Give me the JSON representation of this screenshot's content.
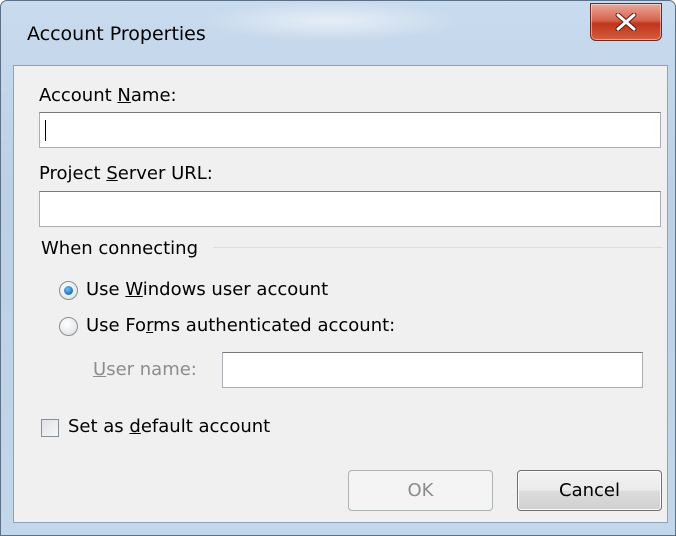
{
  "window": {
    "title": "Account Properties",
    "close_icon": "close-x-icon"
  },
  "fields": {
    "account_name": {
      "label_pre": "Account ",
      "label_key": "N",
      "label_post": "ame:",
      "value": ""
    },
    "project_server_url": {
      "label_pre": "Project ",
      "label_key": "S",
      "label_post": "erver URL:",
      "value": ""
    }
  },
  "connecting": {
    "group_label": "When connecting",
    "windows_option": {
      "label_pre": "Use ",
      "label_key": "W",
      "label_post": "indows user account",
      "checked": true
    },
    "forms_option": {
      "label_pre": "Use Fo",
      "label_key": "r",
      "label_post": "ms authenticated account:",
      "checked": false
    },
    "username": {
      "label_key": "U",
      "label_post": "ser name:",
      "value": ""
    }
  },
  "default_account": {
    "label_pre": "Set as ",
    "label_key": "d",
    "label_post": "efault account",
    "checked": false
  },
  "buttons": {
    "ok": "OK",
    "cancel": "Cancel"
  },
  "colors": {
    "close_button": "#c7402a",
    "radio_selected": "#1f6fbd",
    "dialog_background": "#f0f0f0"
  }
}
